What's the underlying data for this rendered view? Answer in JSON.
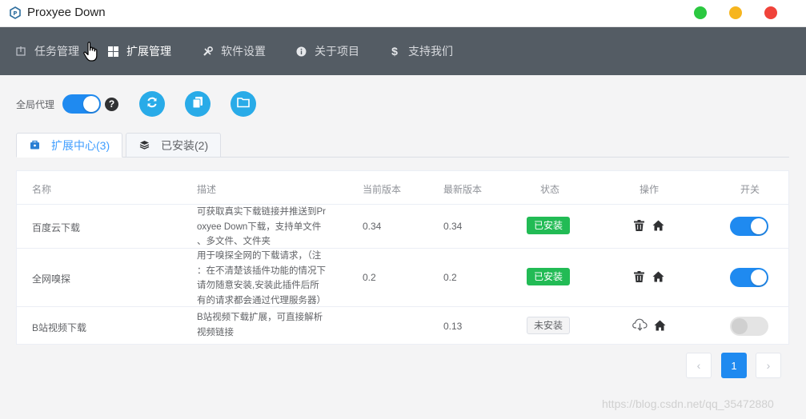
{
  "window": {
    "title": "Proxyee Down",
    "controls": [
      "maximize",
      "minimize",
      "close"
    ]
  },
  "nav": {
    "items": [
      {
        "label": "任务管理",
        "icon": "task-icon",
        "active": false
      },
      {
        "label": "扩展管理",
        "icon": "windows-icon",
        "active": true
      },
      {
        "label": "软件设置",
        "icon": "wrench-icon",
        "active": false
      },
      {
        "label": "关于项目",
        "icon": "info-icon",
        "active": false
      },
      {
        "label": "支持我们",
        "icon": "dollar-icon",
        "active": false
      }
    ]
  },
  "toolbar": {
    "global_proxy_label": "全局代理",
    "global_proxy_on": true,
    "help": "?",
    "buttons": [
      "refresh-icon",
      "copy-icon",
      "folder-icon"
    ]
  },
  "tabs": [
    {
      "label": "扩展中心(3)",
      "icon": "store-icon",
      "active": true
    },
    {
      "label": "已安装(2)",
      "icon": "layers-icon",
      "active": false
    }
  ],
  "table": {
    "columns": [
      "名称",
      "描述",
      "当前版本",
      "最新版本",
      "状态",
      "操作",
      "开关"
    ],
    "rows": [
      {
        "name": "百度云下载",
        "desc": [
          "可获取真实下载链接并推送到Pr",
          "oxyee Down下载，支持单文件",
          "、多文件、文件夹"
        ],
        "current": "0.34",
        "latest": "0.34",
        "status": "已安装",
        "installed": true,
        "ops": [
          "trash-icon",
          "home-icon"
        ],
        "enabled": true
      },
      {
        "name": "全网嗅探",
        "desc": [
          "用于嗅探全网的下载请求，（注",
          "：在不清楚该插件功能的情况下",
          "请勿随意安装,安装此插件后所",
          "有的请求都会通过代理服务器）"
        ],
        "current": "0.2",
        "latest": "0.2",
        "status": "已安装",
        "installed": true,
        "ops": [
          "trash-icon",
          "home-icon"
        ],
        "enabled": true
      },
      {
        "name": "B站视频下载",
        "desc": [
          "B站视频下载扩展，可直接解析",
          "视频链接"
        ],
        "current": "",
        "latest": "0.13",
        "status": "未安装",
        "installed": false,
        "ops": [
          "cloud-download-icon",
          "home-icon"
        ],
        "enabled": false
      }
    ]
  },
  "pagination": {
    "prev": "‹",
    "current": "1",
    "next": "›"
  },
  "watermark": "https://blog.csdn.net/qq_35472880",
  "colors": {
    "nav_bg": "#545c64",
    "accent": "#1f8af0",
    "installed_tag": "#22bb55",
    "round_button": "#29abe8"
  }
}
